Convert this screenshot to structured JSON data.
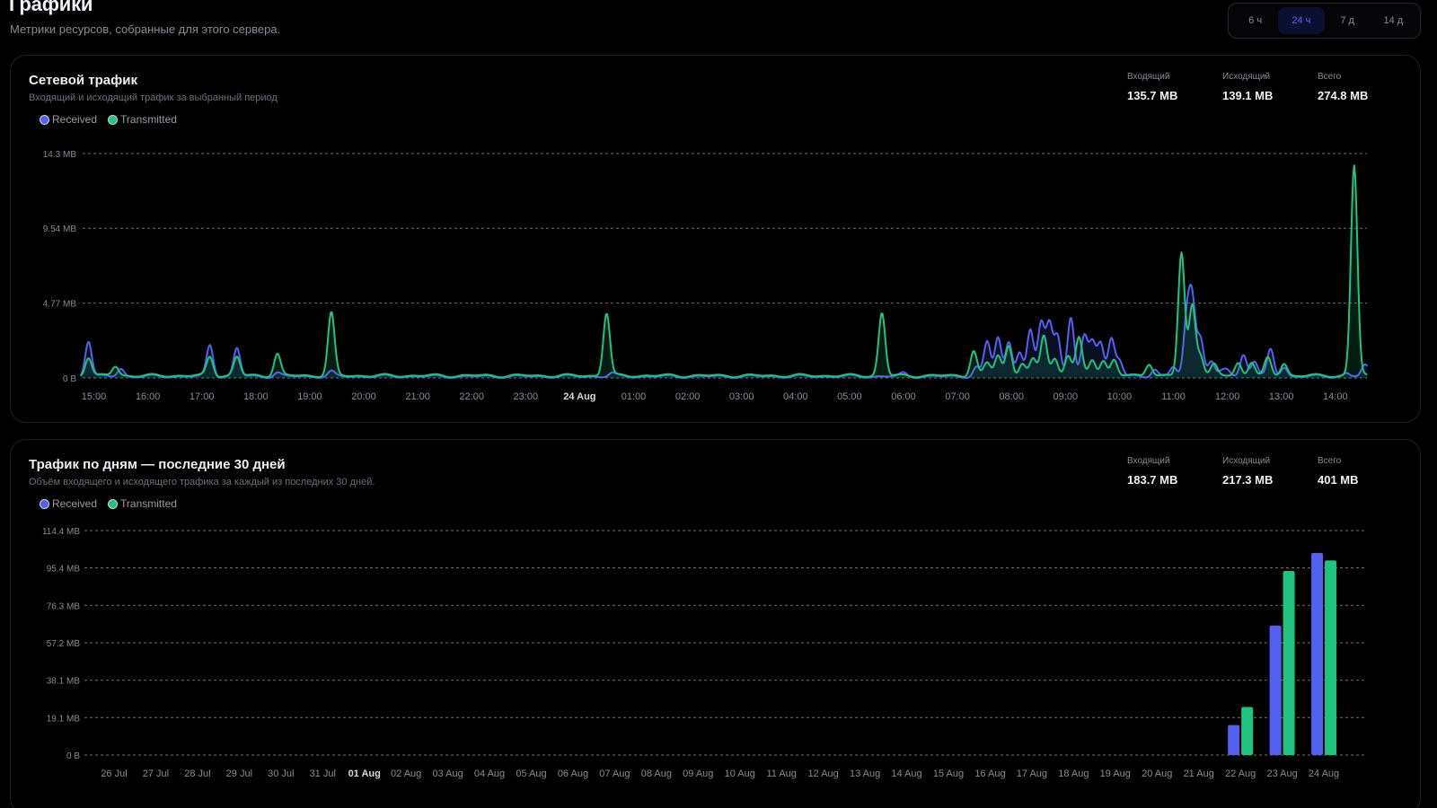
{
  "page": {
    "title": "Графики",
    "subtitle": "Метрики ресурсов, собранные для этого сервера."
  },
  "range": {
    "options": [
      "6 ч",
      "24 ч",
      "7 д",
      "14 д"
    ],
    "selected": "24 ч"
  },
  "colors": {
    "received": "#5460f0",
    "transmitted": "#1fc47e",
    "grid": "#8a8a96",
    "active_range_bg": "#0c1030",
    "active_range_text": "#5b67f0"
  },
  "network": {
    "title": "Сетевой трафик",
    "description": "Входящий и исходящий трафик за выбранный период",
    "stats": [
      {
        "label": "Входящий",
        "value": "135.7 MB"
      },
      {
        "label": "Исходящий",
        "value": "139.1 MB"
      },
      {
        "label": "Всего",
        "value": "274.8 MB"
      }
    ],
    "legend": [
      "Received",
      "Transmitted"
    ]
  },
  "daily": {
    "title": "Трафик по дням — последние 30 дней",
    "description": "Объём входящего и исходящего трафика за каждый из последних 30 дней.",
    "stats": [
      {
        "label": "Входящий",
        "value": "183.7 MB"
      },
      {
        "label": "Исходящий",
        "value": "217.3 MB"
      },
      {
        "label": "Всего",
        "value": "401 MB"
      }
    ],
    "legend": [
      "Received",
      "Transmitted"
    ]
  },
  "chart_data": [
    {
      "type": "area",
      "title": "Сетевой трафик",
      "ylim": [
        0,
        14.3
      ],
      "y_ticks": [
        "0 B",
        "4.77 MB",
        "9.54 MB",
        "14.3 MB"
      ],
      "y_tick_values": [
        0,
        4.77,
        9.54,
        14.3
      ],
      "x_ticks": [
        "15:00",
        "16:00",
        "17:00",
        "18:00",
        "19:00",
        "20:00",
        "21:00",
        "22:00",
        "23:00",
        "24 Aug",
        "01:00",
        "02:00",
        "03:00",
        "04:00",
        "05:00",
        "06:00",
        "07:00",
        "08:00",
        "09:00",
        "10:00",
        "11:00",
        "12:00",
        "13:00",
        "14:00"
      ],
      "x_tick_bold": "24 Aug",
      "x_range_hours": [
        -0.25,
        23.6
      ],
      "grid": true,
      "legend": "top-left",
      "series": [
        {
          "name": "Received",
          "baseline": 0.1,
          "peaks": [
            [
              -0.1,
              2.3
            ],
            [
              0.5,
              0.5
            ],
            [
              2.15,
              2.0
            ],
            [
              2.65,
              1.8
            ],
            [
              3.4,
              0.25
            ],
            [
              4.4,
              0.3
            ],
            [
              9.6,
              0.2
            ],
            [
              15.0,
              0.2
            ],
            [
              16.35,
              0.6
            ],
            [
              16.55,
              2.2
            ],
            [
              16.75,
              2.5
            ],
            [
              16.95,
              2.2
            ],
            [
              17.15,
              1.6
            ],
            [
              17.35,
              2.9
            ],
            [
              17.55,
              3.4
            ],
            [
              17.7,
              3.4
            ],
            [
              17.85,
              2.6
            ],
            [
              18.1,
              3.8
            ],
            [
              18.35,
              2.5
            ],
            [
              18.5,
              2.2
            ],
            [
              18.65,
              2.2
            ],
            [
              18.85,
              2.4
            ],
            [
              19.0,
              1.0
            ],
            [
              19.65,
              0.5
            ],
            [
              20.0,
              0.6
            ],
            [
              20.25,
              3.5
            ],
            [
              20.35,
              4.6
            ],
            [
              20.5,
              2.5
            ],
            [
              20.7,
              0.9
            ],
            [
              20.9,
              0.3
            ],
            [
              21.0,
              0.4
            ],
            [
              21.3,
              1.4
            ],
            [
              21.5,
              1.0
            ],
            [
              21.8,
              1.7
            ],
            [
              22.05,
              0.6
            ],
            [
              23.2,
              0.2
            ],
            [
              23.55,
              0.7
            ]
          ]
        },
        {
          "name": "Transmitted",
          "baseline": 0.15,
          "peaks": [
            [
              -0.1,
              1.2
            ],
            [
              0.4,
              0.6
            ],
            [
              2.15,
              1.2
            ],
            [
              2.65,
              1.2
            ],
            [
              3.4,
              1.4
            ],
            [
              4.4,
              4.0
            ],
            [
              9.5,
              4.0
            ],
            [
              14.6,
              4.0
            ],
            [
              16.3,
              1.6
            ],
            [
              16.55,
              0.8
            ],
            [
              16.75,
              1.3
            ],
            [
              16.95,
              1.9
            ],
            [
              17.2,
              0.8
            ],
            [
              17.4,
              1.0
            ],
            [
              17.6,
              2.6
            ],
            [
              17.8,
              1.1
            ],
            [
              18.05,
              1.3
            ],
            [
              18.25,
              2.4
            ],
            [
              18.5,
              1.0
            ],
            [
              18.7,
              1.0
            ],
            [
              18.9,
              1.0
            ],
            [
              19.55,
              0.8
            ],
            [
              20.15,
              7.8
            ],
            [
              20.35,
              4.5
            ],
            [
              20.5,
              1.3
            ],
            [
              20.75,
              0.7
            ],
            [
              21.2,
              0.8
            ],
            [
              21.45,
              0.9
            ],
            [
              21.75,
              1.1
            ],
            [
              22.05,
              0.8
            ],
            [
              23.35,
              13.4
            ],
            [
              23.95,
              2.2
            ]
          ]
        }
      ]
    },
    {
      "type": "bar",
      "title": "Трафик по дням — последние 30 дней",
      "ylim": [
        0,
        114.4
      ],
      "y_ticks": [
        "0 B",
        "19.1 MB",
        "38.1 MB",
        "57.2 MB",
        "76.3 MB",
        "95.4 MB",
        "114.4 MB"
      ],
      "y_tick_values": [
        0,
        19.1,
        38.1,
        57.2,
        76.3,
        95.4,
        114.4
      ],
      "categories": [
        "26 Jul",
        "27 Jul",
        "28 Jul",
        "29 Jul",
        "30 Jul",
        "31 Jul",
        "01 Aug",
        "02 Aug",
        "03 Aug",
        "04 Aug",
        "05 Aug",
        "06 Aug",
        "07 Aug",
        "08 Aug",
        "09 Aug",
        "10 Aug",
        "11 Aug",
        "12 Aug",
        "13 Aug",
        "14 Aug",
        "15 Aug",
        "16 Aug",
        "17 Aug",
        "18 Aug",
        "19 Aug",
        "20 Aug",
        "21 Aug",
        "22 Aug",
        "23 Aug",
        "24 Aug"
      ],
      "x_tick_bold": "01 Aug",
      "grid": true,
      "legend": "top-left",
      "series": [
        {
          "name": "Received",
          "values": [
            0,
            0,
            0,
            0,
            0,
            0,
            0,
            0,
            0,
            0,
            0,
            0,
            0,
            0,
            0,
            0,
            0,
            0,
            0,
            0,
            0,
            0,
            0,
            0,
            0,
            0,
            0,
            15.3,
            66.0,
            103.0
          ]
        },
        {
          "name": "Transmitted",
          "values": [
            0,
            0,
            0,
            0,
            0,
            0,
            0,
            0,
            0,
            0,
            0,
            0,
            0,
            0,
            0,
            0,
            0,
            0,
            0,
            0,
            0,
            0,
            0,
            0,
            0,
            0,
            0,
            24.5,
            93.8,
            99.2
          ]
        }
      ]
    }
  ]
}
